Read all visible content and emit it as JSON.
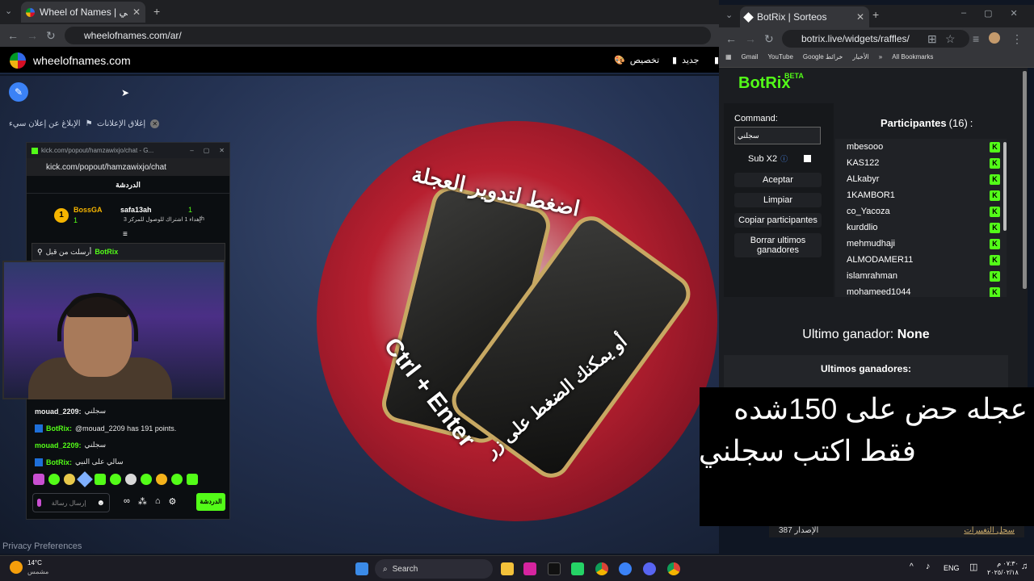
{
  "main_browser": {
    "tab_title": "Wheel of Names | اسم العشوائي",
    "url": "wheelofnames.com/ar/"
  },
  "site_header": {
    "site_name": "wheelofnames.com",
    "customize": "تخصيص",
    "new": "جديد"
  },
  "ad_links": {
    "report_ad": "الإبلاغ عن إعلان سيء",
    "close_ads": "إغلاق الإعلانات"
  },
  "wheel": {
    "press_text": "اضغط لتدوير العجلة",
    "or_text": "أو يمكنك الضغط على زر",
    "shortcut": "Ctrl + Enter"
  },
  "kick_popup": {
    "title": "kick.com/popout/hamzawixjo/chat - G...",
    "url": "kick.com/popout/hamzawixjo/chat",
    "chat_header": "الدردشة",
    "leader_rank": "1",
    "leader_name": "BossGA",
    "leader_subs": "1",
    "gifter_name": "safa13ah",
    "gifter_count": "1",
    "gifter_note": "إهداء 1 اشتراك للوصول للمركز 3",
    "gifter_suffix": "th",
    "pinned_sender": "BotRix",
    "pinned_label": "أرسلت من قبل",
    "messages": [
      {
        "user": "mouad_2209:",
        "text": "سجلني"
      },
      {
        "user": "BotRix:",
        "text": "@mouad_2209 has 191 points."
      },
      {
        "user": "mouad_2209:",
        "text": "سجلني"
      },
      {
        "user": "BotRix:",
        "text": "سالي على النبي"
      }
    ],
    "input_placeholder": "إرسال رسالة",
    "chat_button": "الدردشة"
  },
  "botrix_browser": {
    "tab_title": "BotRix | Sorteos",
    "url": "botrix.live/widgets/raffles/",
    "bookmarks": [
      "Gmail",
      "YouTube",
      "Google خرائط",
      "الأخبار",
      "All Bookmarks"
    ]
  },
  "botrix": {
    "logo": "BotRix",
    "beta": "BETA",
    "command_label": "Command:",
    "command_value": "سجلني",
    "subx2_label": "Sub X2",
    "accept": "Aceptar",
    "clear": "Limpiar",
    "copy": "Copiar participantes",
    "delete_last": "Borrar ultimos ganadores",
    "participants_label": "Participantes",
    "participants_count": "(16)",
    "participants_colon": ":",
    "participants": [
      "mbesooo",
      "KAS122",
      "ALkabyr",
      "1KAMBOR1",
      "co_Yacoza",
      "kurddlio",
      "mehmudhaji",
      "ALMODAMER11",
      "islamrahman",
      "mohameed1044"
    ],
    "last_winner_label": "Ultimo ganador:",
    "last_winner_value": "None",
    "last_winners_label": "Ultimos ganadores:",
    "version_label": "الإصدار 387",
    "changelog": "سجل التغييرات"
  },
  "overlay": {
    "line1": "عجله حض على 150شده",
    "line2": "فقط اكتب سجلني"
  },
  "privacy": "Privacy Preferences",
  "taskbar": {
    "weather_temp": "14°C",
    "weather_desc": "مشمس",
    "search": "Search",
    "lang": "ENG",
    "time": "٠٧:٣٠ م",
    "date": "٢٠٢٥/٠٢/١٨"
  }
}
